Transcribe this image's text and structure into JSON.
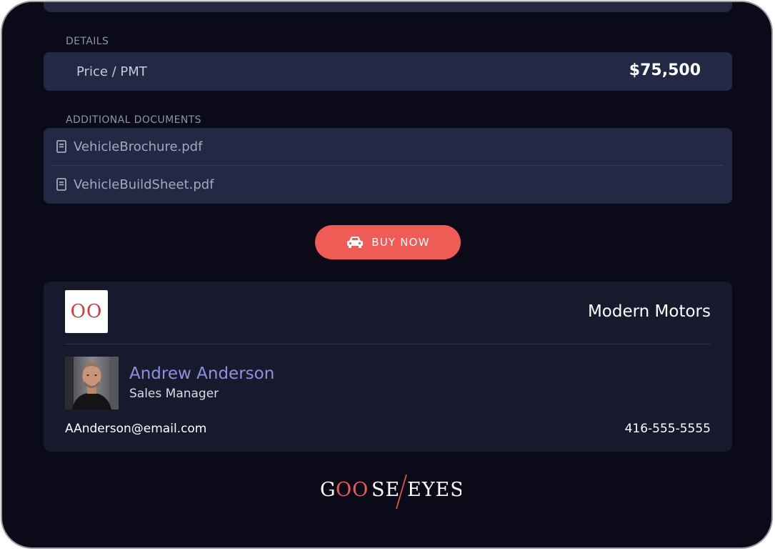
{
  "details": {
    "section_label": "DETAILS",
    "price_label": "Price / PMT",
    "price_value": "$75,500"
  },
  "documents": {
    "section_label": "ADDITIONAL DOCUMENTS",
    "items": [
      {
        "name": "VehicleBrochure.pdf",
        "icon": "document-icon"
      },
      {
        "name": "VehicleBuildSheet.pdf",
        "icon": "document-icon"
      }
    ]
  },
  "buy_button": {
    "label": "BUY NOW",
    "icon": "car-icon"
  },
  "dealer": {
    "logo_text": "OO",
    "name": "Modern Motors"
  },
  "agent": {
    "name": "Andrew Anderson",
    "title": "Sales Manager",
    "email": "AAnderson@email.com",
    "phone": "416-555-5555"
  },
  "brand": {
    "left_text": "GOOSE",
    "right_text": "EYES"
  },
  "colors": {
    "background": "#0a0a18",
    "panel": "#232844",
    "card": "#171a2d",
    "accent": "#ef5b55",
    "agent_name": "#8f8fe0"
  }
}
